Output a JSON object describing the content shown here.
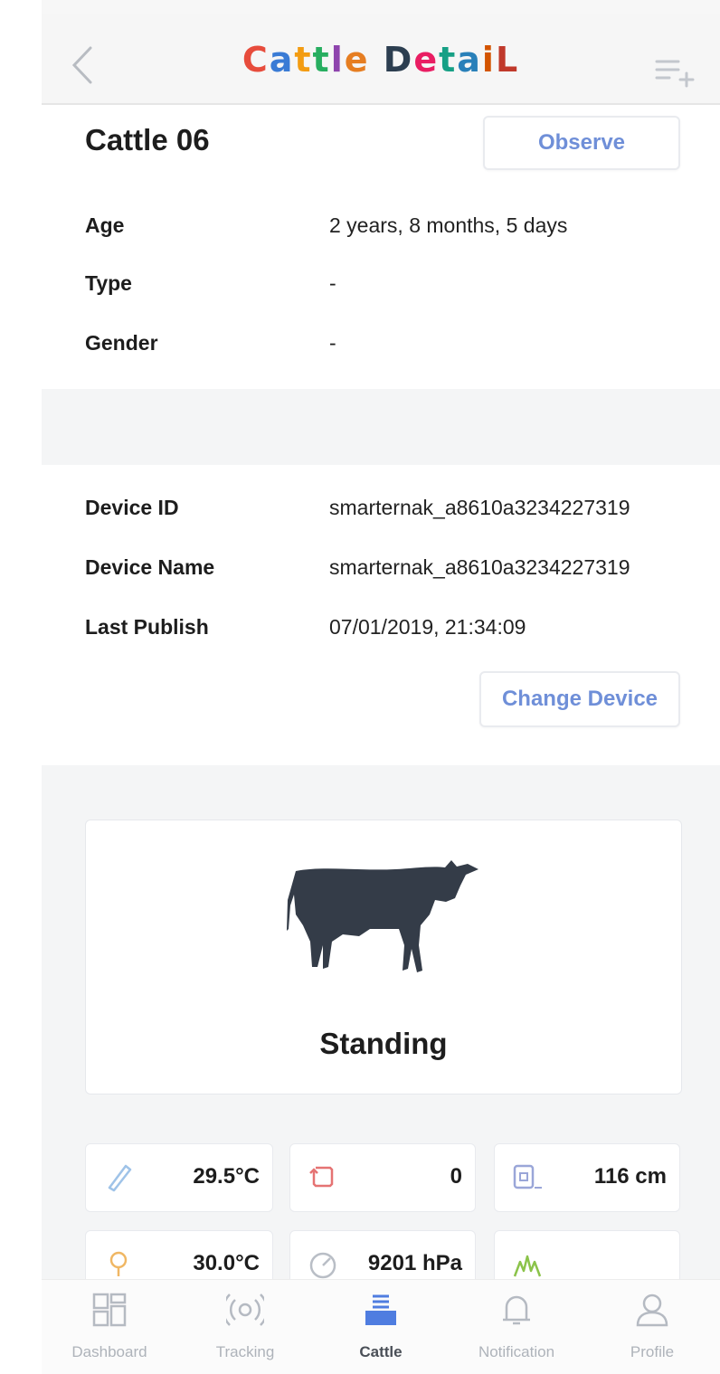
{
  "appbar": {
    "title_letters": [
      {
        "ch": "C",
        "color": "#e74c3c"
      },
      {
        "ch": "a",
        "color": "#3a7bd5"
      },
      {
        "ch": "t",
        "color": "#f39c12"
      },
      {
        "ch": "t",
        "color": "#27ae60"
      },
      {
        "ch": "l",
        "color": "#8e44ad"
      },
      {
        "ch": "e",
        "color": "#e67e22"
      },
      {
        "ch": " ",
        "color": "#000000"
      },
      {
        "ch": "D",
        "color": "#2c3e50"
      },
      {
        "ch": "e",
        "color": "#e91e63"
      },
      {
        "ch": "t",
        "color": "#16a085"
      },
      {
        "ch": "a",
        "color": "#2980b9"
      },
      {
        "ch": "i",
        "color": "#d35400"
      },
      {
        "ch": "L",
        "color": "#c0392b"
      }
    ],
    "back_icon": "chevron-left-icon",
    "menu_icon": "playlist-add-icon"
  },
  "cattle": {
    "name": "Cattle 06",
    "observe_label": "Observe",
    "fields": [
      {
        "label": "Age",
        "value": "2 years, 8 months, 5 days"
      },
      {
        "label": "Type",
        "value": "-"
      },
      {
        "label": "Gender",
        "value": "-"
      }
    ]
  },
  "device": {
    "fields": [
      {
        "label": "Device ID",
        "value": "smarternak_a8610a3234227319"
      },
      {
        "label": "Device Name",
        "value": "smarternak_a8610a3234227319"
      },
      {
        "label": "Last Publish",
        "value": "07/01/2019, 21:34:09"
      }
    ],
    "change_label": "Change Device"
  },
  "status": {
    "icon": "cow-icon",
    "label": "Standing"
  },
  "sensors": [
    {
      "icon": "thermometer-icon",
      "value": "29.5°C",
      "color": "#9fc3e8"
    },
    {
      "icon": "rotate-icon",
      "value": "0",
      "color": "#e57373"
    },
    {
      "icon": "height-icon",
      "value": "116 cm",
      "color": "#9aa6d8"
    },
    {
      "icon": "temperature-icon",
      "value": "30.0°C",
      "color": "#f0b764"
    },
    {
      "icon": "gauge-icon",
      "value": "9201 hPa",
      "color": "#b9bec6"
    },
    {
      "icon": "grass-icon",
      "value": "",
      "color": "#8bc34a"
    }
  ],
  "nav": {
    "items": [
      {
        "label": "Dashboard",
        "icon": "dashboard-icon"
      },
      {
        "label": "Tracking",
        "icon": "tracking-icon"
      },
      {
        "label": "Cattle",
        "icon": "cattle-icon"
      },
      {
        "label": "Notification",
        "icon": "bell-icon"
      },
      {
        "label": "Profile",
        "icon": "profile-icon"
      }
    ],
    "active_color": "#4f7de0",
    "inactive_color": "#b5bac2"
  }
}
